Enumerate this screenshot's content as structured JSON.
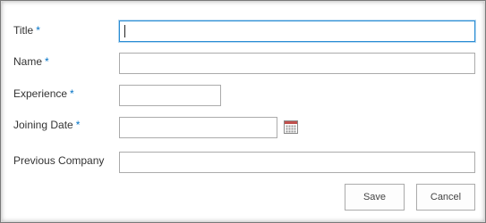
{
  "form": {
    "required_marker": "*",
    "fields": {
      "title": {
        "label": "Title",
        "value": ""
      },
      "name": {
        "label": "Name",
        "value": ""
      },
      "experience": {
        "label": "Experience",
        "value": ""
      },
      "joining_date": {
        "label": "Joining Date",
        "value": ""
      },
      "previous_company": {
        "label": "Previous Company",
        "value": ""
      }
    }
  },
  "buttons": {
    "save": "Save",
    "cancel": "Cancel"
  },
  "icons": {
    "date_picker": "calendar-icon"
  },
  "colors": {
    "required_marker": "#0072c6",
    "focus_border": "#2a8dd4",
    "input_border": "#ababab"
  }
}
